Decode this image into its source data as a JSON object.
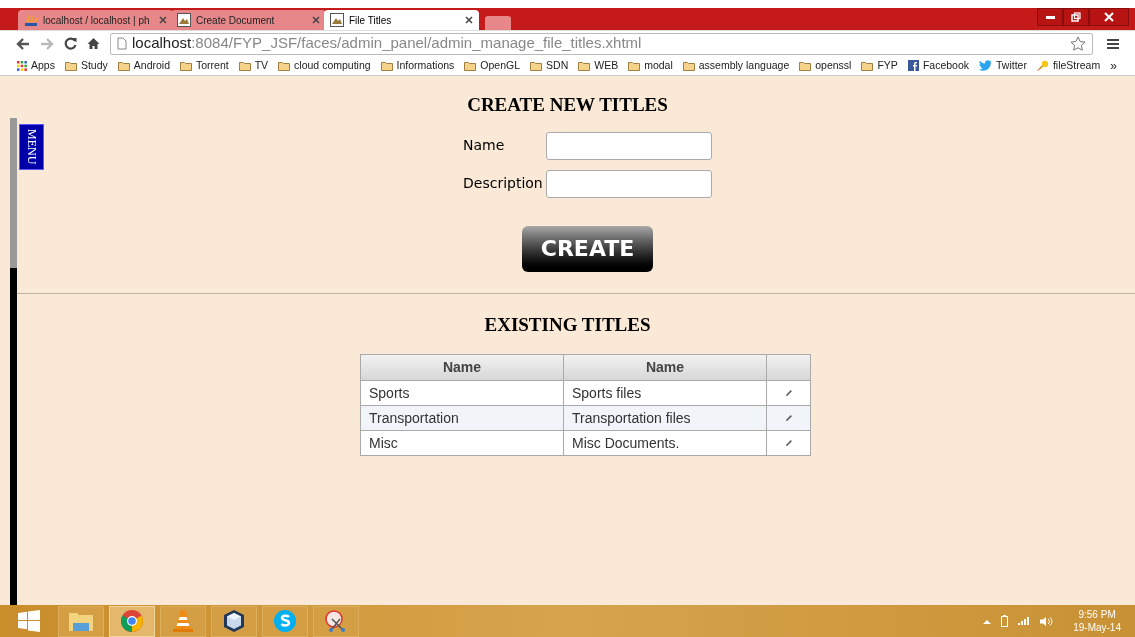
{
  "tabs": [
    {
      "label": "localhost / localhost | ph",
      "kind": "pma",
      "selected": false
    },
    {
      "label": "Create Document",
      "kind": "doc",
      "selected": false
    },
    {
      "label": "File Titles",
      "kind": "doc",
      "selected": true
    }
  ],
  "address": {
    "host": "localhost",
    "rest": ":8084/FYP_JSF/faces/admin_panel/admin_manage_file_titles.xhtml"
  },
  "bookmarks": [
    {
      "label": "Apps",
      "kind": "apps"
    },
    {
      "label": "Study",
      "kind": "folder"
    },
    {
      "label": "Android",
      "kind": "folder"
    },
    {
      "label": "Torrent",
      "kind": "folder"
    },
    {
      "label": "TV",
      "kind": "folder"
    },
    {
      "label": "cloud computing",
      "kind": "folder"
    },
    {
      "label": "Informations",
      "kind": "folder"
    },
    {
      "label": "OpenGL",
      "kind": "folder"
    },
    {
      "label": "SDN",
      "kind": "folder"
    },
    {
      "label": "WEB",
      "kind": "folder"
    },
    {
      "label": "modal",
      "kind": "folder"
    },
    {
      "label": "assembly language",
      "kind": "folder"
    },
    {
      "label": "openssl",
      "kind": "folder"
    },
    {
      "label": "FYP",
      "kind": "folder"
    },
    {
      "label": "Facebook",
      "kind": "facebook"
    },
    {
      "label": "Twitter",
      "kind": "twitter"
    },
    {
      "label": "fileStream",
      "kind": "bulb"
    }
  ],
  "bookmarks_more": "»",
  "menu_tab": "MENU",
  "create_heading": "CREATE NEW TITLES",
  "fields": [
    {
      "label": "Name"
    },
    {
      "label": "Description"
    }
  ],
  "create_button": "CREATE",
  "existing_heading": "EXISTING TITLES",
  "table": {
    "columns": [
      "Name",
      "Name"
    ],
    "rows": [
      [
        "Sports",
        "Sports files"
      ],
      [
        "Transportation",
        "Transportation files"
      ],
      [
        "Misc",
        "Misc Documents."
      ]
    ]
  },
  "taskbar": {
    "apps": [
      {
        "kind": "folder",
        "selected": false
      },
      {
        "kind": "chrome",
        "selected": true
      },
      {
        "kind": "cone",
        "selected": false
      },
      {
        "kind": "cube",
        "selected": false
      },
      {
        "kind": "skype",
        "selected": false
      },
      {
        "kind": "scissors",
        "selected": false
      }
    ],
    "time": "9:56 PM",
    "date": "19-May-14"
  }
}
